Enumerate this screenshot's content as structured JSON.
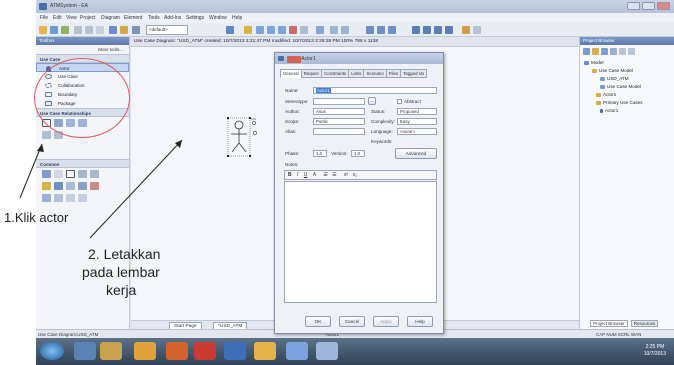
{
  "window": {
    "title": "ATMSystem - EA"
  },
  "menu": [
    "File",
    "Edit",
    "View",
    "Project",
    "Diagram",
    "Element",
    "Tools",
    "Add-Ins",
    "Settings",
    "Window",
    "Help"
  ],
  "toolbar": {
    "style_select": "<default>"
  },
  "diagram_tab": {
    "label": "Use Case Diagram: \"USD_ATM\"  created: 10/7/2013 2:21:47 PM  modified: 10/7/2013 2:28:28 PM  100%  788 x 1138"
  },
  "toolbox": {
    "title": "Toolbox",
    "more": "More tools...",
    "section_use_case": "Use Case",
    "items": [
      "Actor",
      "Use Case",
      "Collaboration",
      "Boundary",
      "Package"
    ],
    "section_relationships": "Use Case Relationships",
    "section_common": "Common"
  },
  "dialog": {
    "title": "Actor: Actor1",
    "tabs": [
      "General",
      "Require",
      "Constraints",
      "Links",
      "Scenario",
      "Files",
      "Tagged Va"
    ],
    "fields": {
      "name_label": "Name:",
      "name_value": "Actor1",
      "stereotype_label": "Stereotype:",
      "author_label": "Author:",
      "author_value": "Asus",
      "scope_label": "Scope:",
      "scope_value": "Public",
      "alias_label": "Alias:",
      "abstract_label": "Abstract",
      "status_label": "Status:",
      "status_value": "Proposed",
      "complexity_label": "Complexity:",
      "complexity_value": "Easy",
      "language_label": "Language:",
      "language_value": "<none>",
      "keywords_label": "Keywords:",
      "phase_label": "Phase:",
      "phase_value": "1.0",
      "version_label": "Version:",
      "version_value": "1.0",
      "advanced_button": "Advanced",
      "notes_label": "Notes:"
    },
    "buttons": {
      "ok": "OK",
      "cancel": "Cancel",
      "apply": "Apply",
      "help": "Help"
    }
  },
  "browser": {
    "title": "Project Browser",
    "tree": [
      "Model",
      "Use Case Model",
      "USD_ATM",
      "Use Case Model",
      "Actors",
      "Primary Use Cases",
      "Actor1"
    ]
  },
  "bottom_tabs": {
    "start_page": "Start Page",
    "diagram": "*USD_ATM"
  },
  "right_tabs": {
    "browser": "Project Browser",
    "resources": "Resources"
  },
  "status": {
    "left": "Use Case Diagram:USD_ATM",
    "middle": "Actor1",
    "right": "CAP  NUM  SCRL  WAN"
  },
  "clock": {
    "time": "2:25 PM",
    "date": "10/7/2013"
  },
  "annotations": {
    "step1": "1.Klik actor",
    "step2_line1": "2. Letakkan",
    "step2_line2": "pada  lembar",
    "step2_line3": "kerja"
  },
  "colors": {
    "annotation_circle": "#e0575c",
    "title_blue": "#5d79ad",
    "taskbar": "#2f4257"
  }
}
